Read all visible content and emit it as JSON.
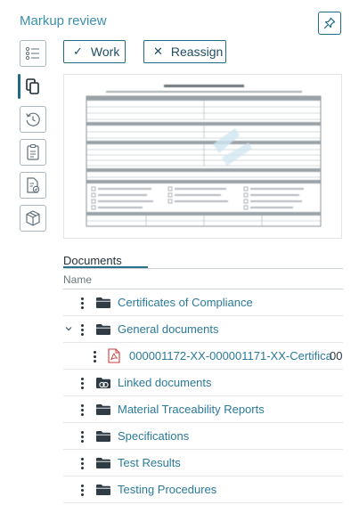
{
  "header": {
    "title": "Markup review",
    "pin_icon": "pin-icon"
  },
  "rail": {
    "items": [
      {
        "name": "list-icon",
        "active": false
      },
      {
        "name": "copy-icon",
        "active": true
      },
      {
        "name": "history-icon",
        "active": false
      },
      {
        "name": "clipboard-icon",
        "active": false
      },
      {
        "name": "document-check-icon",
        "active": false
      },
      {
        "name": "package-icon",
        "active": false
      }
    ]
  },
  "actions": {
    "work_label": "Work",
    "work_icon": "check-icon",
    "reassign_label": "Reassign",
    "reassign_icon": "close-icon"
  },
  "documents": {
    "tab_label": "Documents",
    "column_name": "Name",
    "rows": [
      {
        "label": "Certificates of Compliance",
        "icon": "folder-icon"
      },
      {
        "label": "General documents",
        "icon": "folder-icon",
        "expanded": true
      },
      {
        "label": "000001172-XX-000001171-XX-Certifica",
        "extra": "00",
        "icon": "pdf-icon"
      },
      {
        "label": "Linked documents",
        "icon": "linked-folder-icon"
      },
      {
        "label": "Material Traceability Reports",
        "icon": "folder-icon"
      },
      {
        "label": "Specifications",
        "icon": "folder-icon"
      },
      {
        "label": "Test Results",
        "icon": "folder-icon"
      },
      {
        "label": "Testing Procedures",
        "icon": "folder-icon"
      }
    ]
  },
  "colors": {
    "accent": "#1f6b86",
    "link": "#2a7a9a",
    "title": "#3b8fae",
    "pdf": "#d23a3a"
  }
}
